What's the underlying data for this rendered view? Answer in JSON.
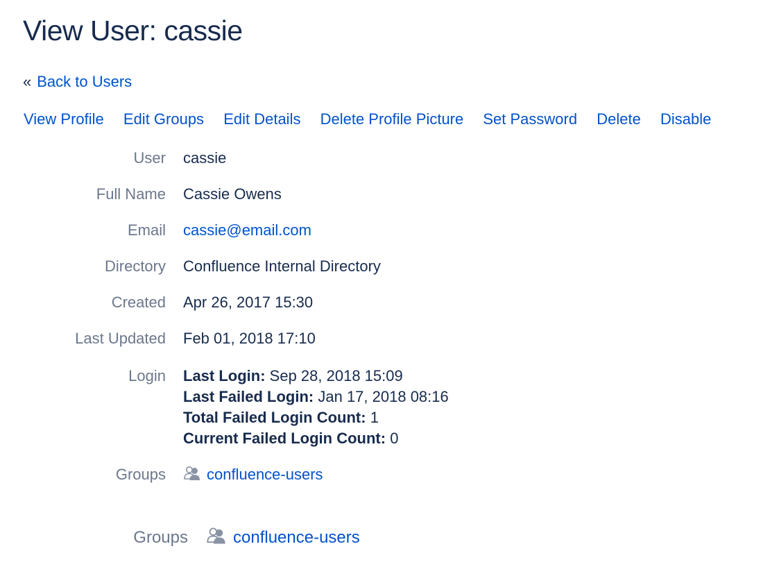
{
  "page_title": "View User: cassie",
  "back": {
    "arrow": "«",
    "label": "Back to Users"
  },
  "actions": [
    "View Profile",
    "Edit Groups",
    "Edit Details",
    "Delete Profile Picture",
    "Set Password",
    "Delete",
    "Disable"
  ],
  "fields": {
    "user": {
      "label": "User",
      "value": "cassie"
    },
    "full_name": {
      "label": "Full Name",
      "value": "Cassie Owens"
    },
    "email": {
      "label": "Email",
      "value": "cassie@email.com"
    },
    "directory": {
      "label": "Directory",
      "value": "Confluence Internal Directory"
    },
    "created": {
      "label": "Created",
      "value": "Apr 26, 2017 15:30"
    },
    "last_updated": {
      "label": "Last Updated",
      "value": "Feb 01, 2018 17:10"
    },
    "login": {
      "label": "Login",
      "lines": [
        {
          "key": "Last Login:",
          "value": "Sep 28, 2018 15:09"
        },
        {
          "key": "Last Failed Login:",
          "value": "Jan 17, 2018 08:16"
        },
        {
          "key": "Total Failed Login Count:",
          "value": "1"
        },
        {
          "key": "Current Failed Login Count:",
          "value": "0"
        }
      ]
    },
    "groups": {
      "label": "Groups",
      "value": "confluence-users",
      "icon": "group-icon"
    }
  },
  "groups_zoom": {
    "label": "Groups",
    "value": "confluence-users",
    "icon": "group-icon"
  },
  "colors": {
    "link": "#0052cc",
    "label": "#6b778c",
    "text": "#172b4d"
  }
}
